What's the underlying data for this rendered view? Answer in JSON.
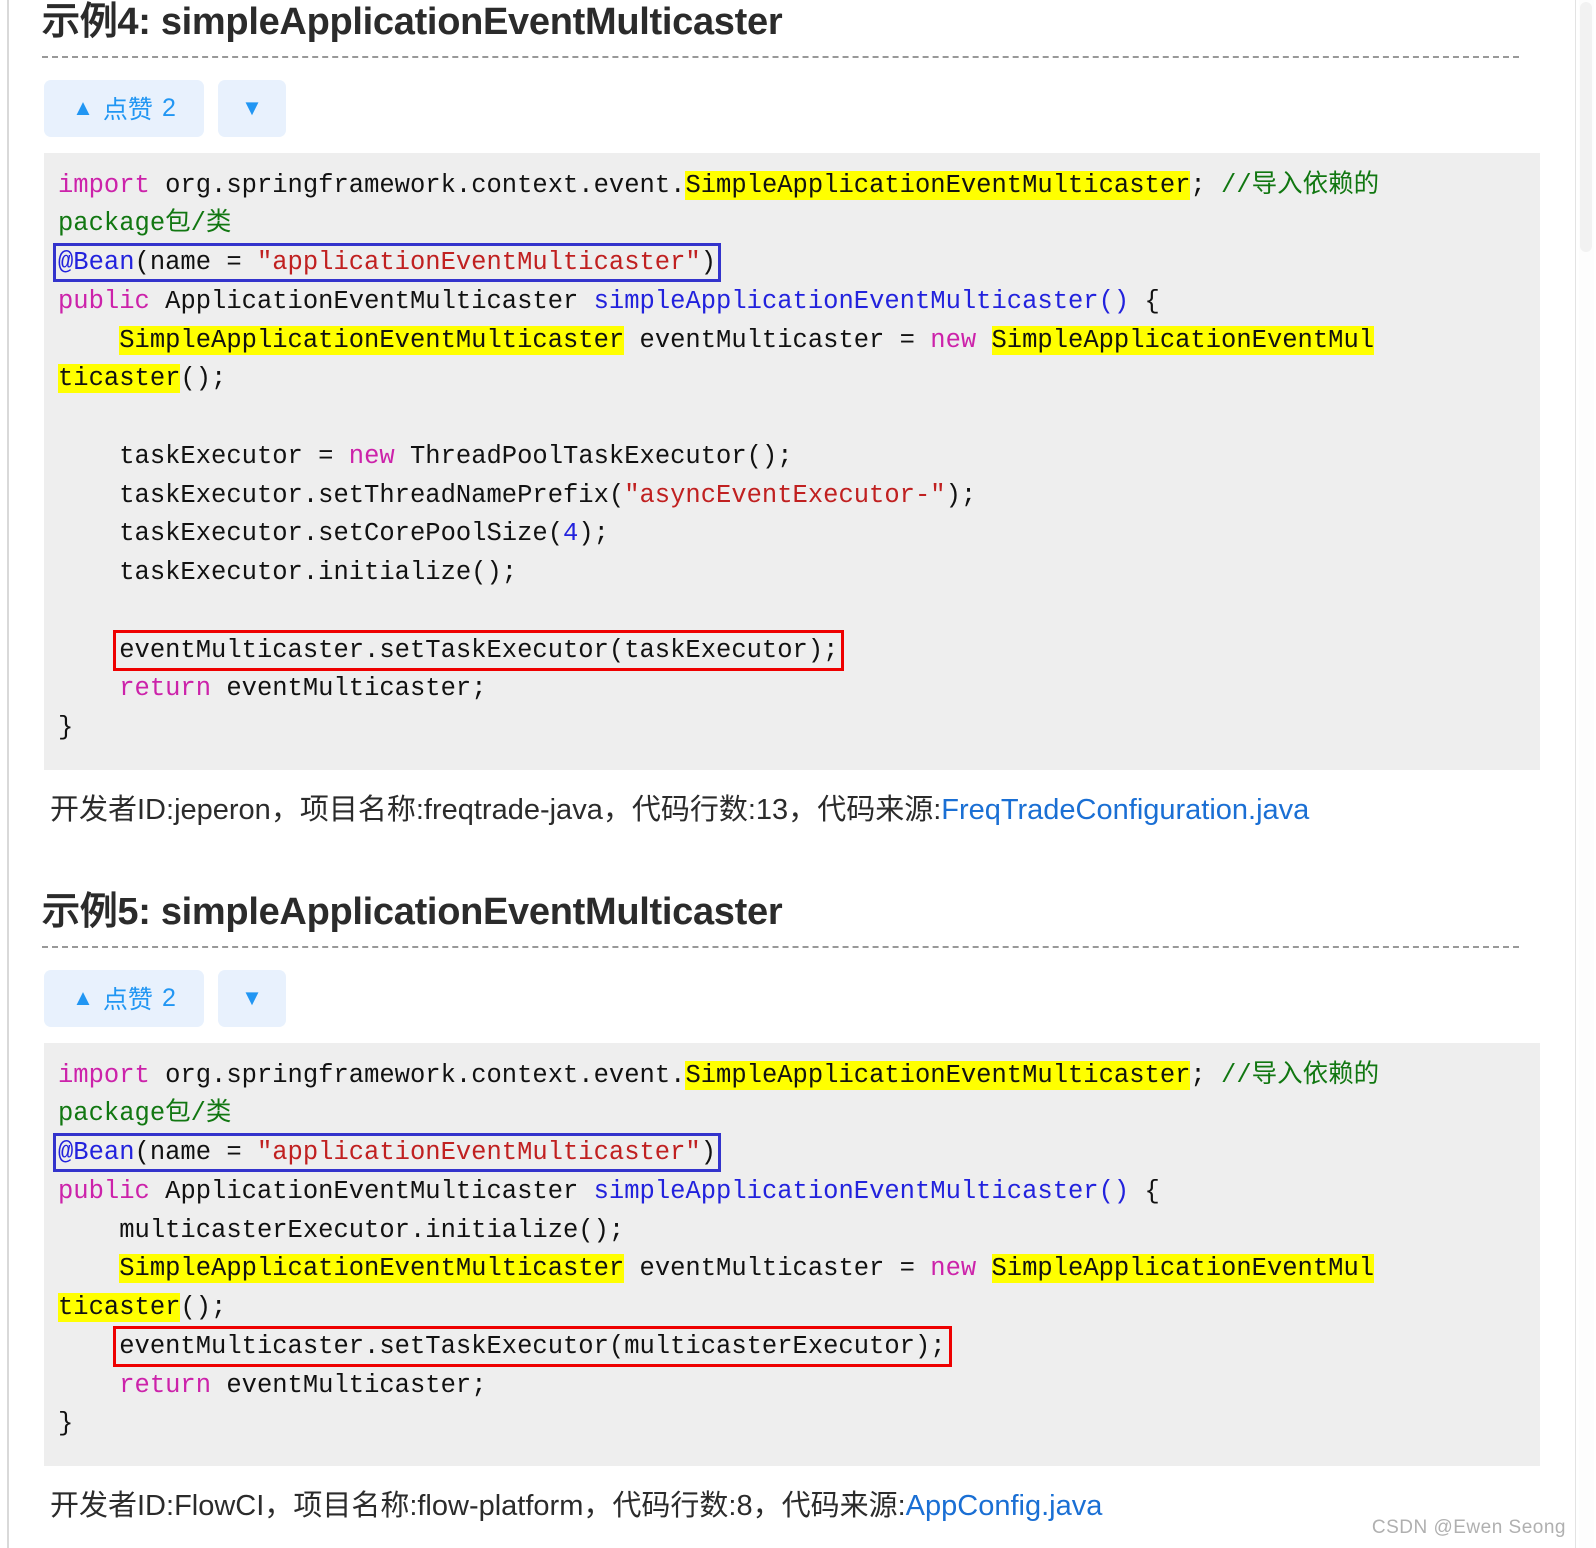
{
  "page": {
    "watermark": "CSDN @Ewen Seong"
  },
  "sections": [
    {
      "title": "示例4: simpleApplicationEventMulticaster",
      "vote": {
        "up_icon": "triangle-up-icon",
        "up_label": "点赞",
        "up_count": "2",
        "down_icon": "triangle-down-icon"
      },
      "code_lines": [
        "import org.springframework.context.event.SimpleApplicationEventMulticaster; //导入依赖的package包/类",
        "@Bean(name = \"applicationEventMulticaster\")",
        "public ApplicationEventMulticaster simpleApplicationEventMulticaster() {",
        "    SimpleApplicationEventMulticaster eventMulticaster = new SimpleApplicationEventMulticaster();",
        "",
        "    taskExecutor = new ThreadPoolTaskExecutor();",
        "    taskExecutor.setThreadNamePrefix(\"asyncEventExecutor-\");",
        "    taskExecutor.setCorePoolSize(4);",
        "    taskExecutor.initialize();",
        "",
        "    eventMulticaster.setTaskExecutor(taskExecutor);",
        "    return eventMulticaster;",
        "}"
      ],
      "attribution": {
        "developer_label": "开发者ID:",
        "developer": "jeperon",
        "sep1": "，",
        "project_label": "项目名称:",
        "project": "freqtrade-java",
        "sep2": "，",
        "lines_label": "代码行数:",
        "lines": "13",
        "sep3": "，",
        "source_label": "代码来源:",
        "source_file": "FreqTradeConfiguration.java"
      }
    },
    {
      "title": "示例5: simpleApplicationEventMulticaster",
      "vote": {
        "up_icon": "triangle-up-icon",
        "up_label": "点赞",
        "up_count": "2",
        "down_icon": "triangle-down-icon"
      },
      "code_lines": [
        "import org.springframework.context.event.SimpleApplicationEventMulticaster; //导入依赖的package包/类",
        "@Bean(name = \"applicationEventMulticaster\")",
        "public ApplicationEventMulticaster simpleApplicationEventMulticaster() {",
        "    multicasterExecutor.initialize();",
        "    SimpleApplicationEventMulticaster eventMulticaster = new SimpleApplicationEventMulticaster();",
        "    eventMulticaster.setTaskExecutor(multicasterExecutor);",
        "    return eventMulticaster;",
        "}"
      ],
      "attribution": {
        "developer_label": "开发者ID:",
        "developer": "FlowCI",
        "sep1": "，",
        "project_label": "项目名称:",
        "project": "flow-platform",
        "sep2": "，",
        "lines_label": "代码行数:",
        "lines": "8",
        "sep3": "，",
        "source_label": "代码来源:",
        "source_file": "AppConfig.java"
      }
    }
  ]
}
